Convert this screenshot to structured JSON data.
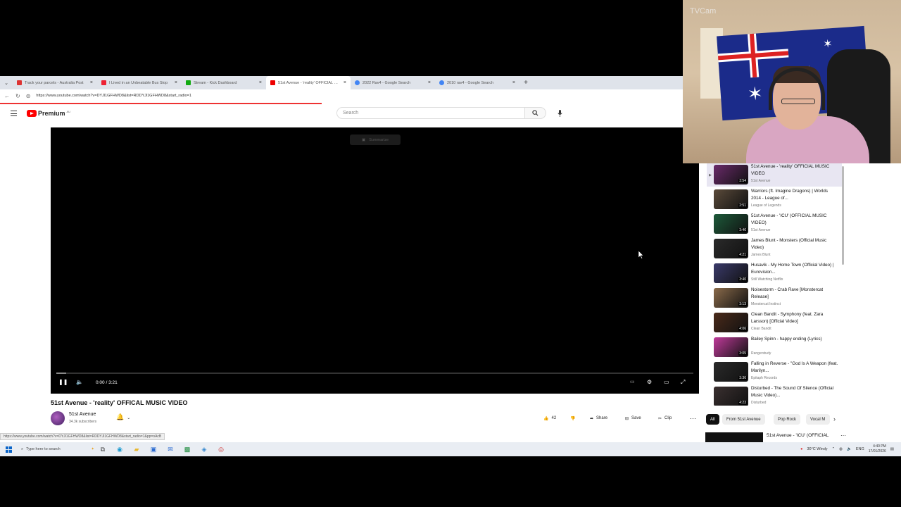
{
  "browser": {
    "tabs": [
      {
        "label": "Track your parcels - Australia Post",
        "color": "#d33"
      },
      {
        "label": "I Lived in an Unbeatable Bus Stop",
        "color": "#e23"
      },
      {
        "label": "Stream - Kick Dashboard",
        "color": "#1a1"
      },
      {
        "label": "51st Avenue - 'reality' OFFICIAL MUSIC",
        "color": "#e00"
      },
      {
        "label": "2022 Rav4 - Google Search",
        "color": "#4285f4"
      },
      {
        "label": "2010 rav4 - Google Search",
        "color": "#4285f4"
      }
    ],
    "url": "https://www.youtube.com/watch?v=DYJl1GFHWD8&list=RDDYJl1GFHWD8&start_radio=1"
  },
  "header": {
    "logo_text": "Premium",
    "logo_sup": "AU",
    "search_placeholder": "Search"
  },
  "player": {
    "summary_label": "Summarize",
    "time": "0:00 / 3:21",
    "progress": 0.0
  },
  "video": {
    "title": "51st Avenue - 'reality' OFFICAL MUSIC VIDEO",
    "channel": "51st Avenue",
    "subscribers": "34.3k subscribers",
    "likes": "42",
    "share": "Share",
    "save": "Save",
    "clip": "Clip",
    "status_url": "https://www.youtube.com/watch?v=DYJl1GFHWD8&list=RDDYJl1GFHWD8&start_radio=1&pp=oAcB"
  },
  "playlist": [
    {
      "title": "51st Avenue - 'reality' OFFICIAL MUSIC VIDEO",
      "channel": "51st Avenue",
      "duration": "3:54",
      "current": true,
      "thumb": "#6a2a6a"
    },
    {
      "title": "Warriors (ft. Imagine Dragons) | Worlds 2014 - League of...",
      "channel": "League of Legends",
      "duration": "2:51",
      "current": false,
      "thumb": "#5a4a3a"
    },
    {
      "title": "51st Avenue - 'ICU' (OFFICIAL MUSIC VIDEO)",
      "channel": "51st Avenue",
      "duration": "3:46",
      "current": false,
      "thumb": "#1d5a3a"
    },
    {
      "title": "James Blunt - Monsters (Official Music Video)",
      "channel": "James Blunt",
      "duration": "4:21",
      "current": false,
      "thumb": "#2a2a2a"
    },
    {
      "title": "Husavik - My Home Town (Official Video) | Eurovision...",
      "channel": "Still Watching Netflix",
      "duration": "3:40",
      "current": false,
      "thumb": "#3a3a6a"
    },
    {
      "title": "Noisestorm - Crab Rave [Monstercat Release]",
      "channel": "Monstercat Instinct",
      "duration": "3:13",
      "current": false,
      "thumb": "#8a6a4a"
    },
    {
      "title": "Clean Bandit - Symphony (feat. Zara Larsson) [Official Video]",
      "channel": "Clean Bandit",
      "duration": "4:06",
      "current": false,
      "thumb": "#4a2a1a"
    },
    {
      "title": "Bailey Spinn - happy ending (Lyrics)",
      "channel": "Rangerstudy",
      "duration": "3:05",
      "current": false,
      "thumb": "#c03a9a"
    },
    {
      "title": "Falling in Reverse - \"God Is A Weapon (feat. Marilyn...",
      "channel": "Epitaph Records",
      "duration": "3:36",
      "current": false,
      "thumb": "#2a2a2a"
    },
    {
      "title": "Disturbed - The Sound Of Silence (Official Music Video)...",
      "channel": "Disturbed",
      "duration": "4:23",
      "current": false,
      "thumb": "#3a3030"
    }
  ],
  "chips": [
    "All",
    "From 51st Avenue",
    "Pop Rock",
    "Vocal M"
  ],
  "next_item_title": "51st Avenue - 'ICU' (OFFICIAL",
  "webcam": {
    "label": "TVCam"
  },
  "taskbar": {
    "search_placeholder": "Type here to search",
    "weather": "30°C  Windy",
    "lang": "ENG",
    "time": "4:40 PM",
    "date": "17/01/2026"
  }
}
